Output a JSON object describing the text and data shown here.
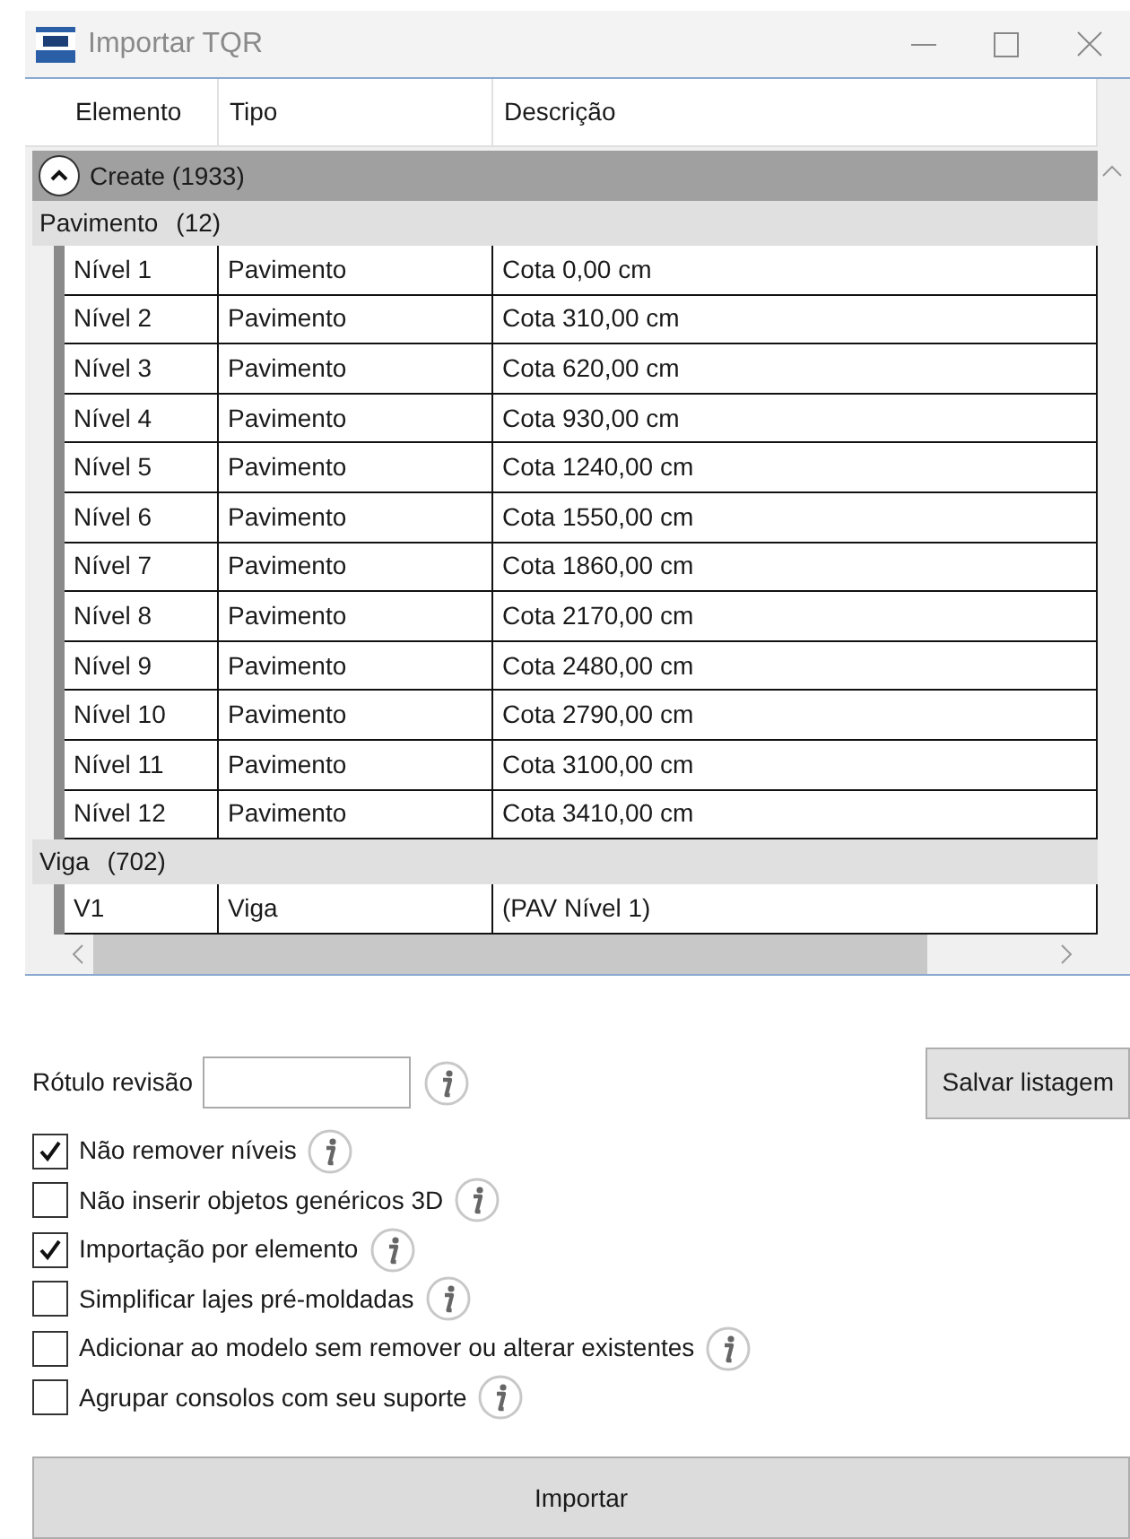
{
  "window": {
    "title": "Importar TQR"
  },
  "table": {
    "columns": [
      "Elemento",
      "Tipo",
      "Descrição"
    ],
    "groups": [
      {
        "label": "Create (1933)",
        "expanded": true,
        "subgroups": [
          {
            "name": "Pavimento",
            "count": "(12)",
            "rows": [
              [
                "Nível 1",
                "Pavimento",
                "Cota 0,00 cm"
              ],
              [
                "Nível 2",
                "Pavimento",
                "Cota 310,00 cm"
              ],
              [
                "Nível 3",
                "Pavimento",
                "Cota 620,00 cm"
              ],
              [
                "Nível 4",
                "Pavimento",
                "Cota 930,00 cm"
              ],
              [
                "Nível 5",
                "Pavimento",
                "Cota 1240,00 cm"
              ],
              [
                "Nível 6",
                "Pavimento",
                "Cota 1550,00 cm"
              ],
              [
                "Nível 7",
                "Pavimento",
                "Cota 1860,00 cm"
              ],
              [
                "Nível 8",
                "Pavimento",
                "Cota 2170,00 cm"
              ],
              [
                "Nível 9",
                "Pavimento",
                "Cota 2480,00 cm"
              ],
              [
                "Nível 10",
                "Pavimento",
                "Cota 2790,00 cm"
              ],
              [
                "Nível 11",
                "Pavimento",
                "Cota 3100,00 cm"
              ],
              [
                "Nível 12",
                "Pavimento",
                "Cota 3410,00 cm"
              ]
            ]
          },
          {
            "name": "Viga",
            "count": "(702)",
            "rows": [
              [
                "V1",
                "Viga",
                "(PAV Nível 1)"
              ]
            ]
          }
        ]
      }
    ]
  },
  "revision": {
    "label": "Rótulo revisão"
  },
  "save_button": "Salvar listagem",
  "options": [
    {
      "label": "Não remover níveis",
      "checked": true
    },
    {
      "label": "Não inserir objetos genéricos 3D",
      "checked": false
    },
    {
      "label": "Importação por elemento",
      "checked": true
    },
    {
      "label": "Simplificar lajes pré-moldadas",
      "checked": false
    },
    {
      "label": "Adicionar ao modelo sem remover ou alterar existentes",
      "checked": false
    },
    {
      "label": "Agrupar consolos com seu suporte",
      "checked": false
    }
  ],
  "import_button": "Importar"
}
